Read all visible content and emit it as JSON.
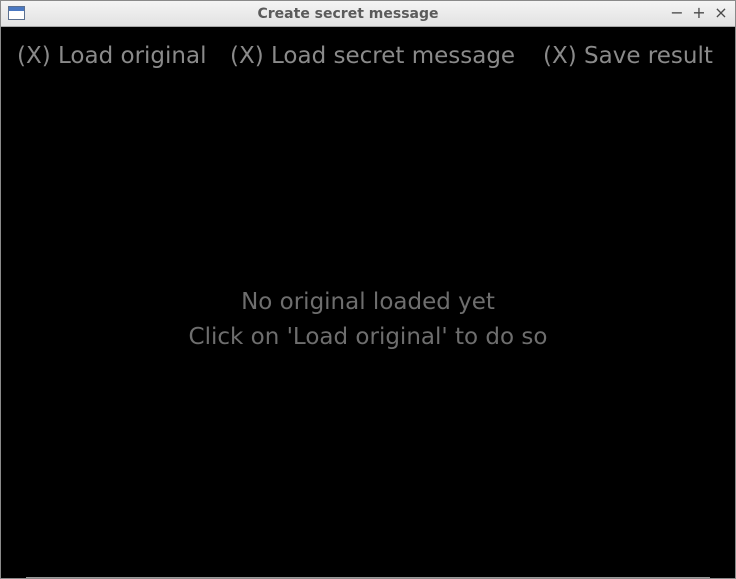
{
  "window": {
    "title": "Create secret message",
    "controls": {
      "minimize": "−",
      "maximize": "+",
      "close": "×"
    }
  },
  "toolbar": {
    "load_original": "(X) Load original",
    "load_secret": "(X) Load secret message",
    "save_result": "(X) Save result"
  },
  "canvas": {
    "message_line1": "No original loaded yet",
    "message_line2": "Click on 'Load original' to do so"
  },
  "colors": {
    "background": "#000000",
    "toolbar_text": "#8a8a8a",
    "message_text": "#6e6e6e"
  }
}
